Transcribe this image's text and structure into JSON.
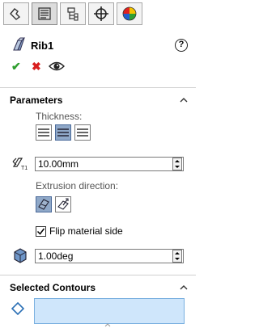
{
  "tabs": [
    {
      "name": "feature-manager",
      "icon": "feature-manager-icon"
    },
    {
      "name": "property-manager",
      "icon": "property-manager-icon",
      "active": true
    },
    {
      "name": "configuration-manager",
      "icon": "configuration-manager-icon"
    },
    {
      "name": "dimxpert-manager",
      "icon": "crosshair-icon"
    },
    {
      "name": "display-manager",
      "icon": "appearance-icon"
    }
  ],
  "header": {
    "title": "Rib1",
    "help_symbol": "?"
  },
  "actions": {
    "ok": "✔",
    "cancel": "✖"
  },
  "parameters": {
    "section_title": "Parameters",
    "thickness_label": "Thickness:",
    "thickness_value": "10.00mm",
    "extrusion_label": "Extrusion direction:",
    "flip_label": "Flip material side",
    "flip_checked": true,
    "draft_value": "1.00deg",
    "thickness_options": [
      "first-side",
      "both-sides",
      "second-side"
    ],
    "selected_thickness_option": "both-sides"
  },
  "selected_contours": {
    "section_title": "Selected Contours"
  },
  "colors": {
    "ok_green": "#2f9e2f",
    "cancel_red": "#d81e1e",
    "selected_button": "#8fa8c8",
    "selection_box": "#cfe6fb"
  }
}
